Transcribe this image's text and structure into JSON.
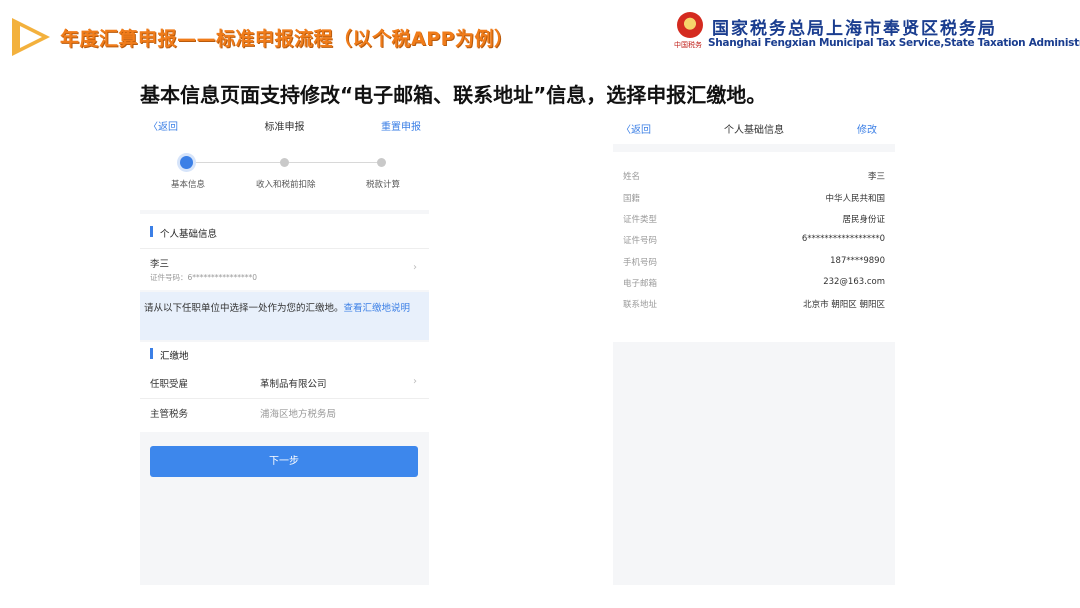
{
  "header": {
    "title": "年度汇算申报——标准申报流程（以个税APP为例）",
    "org_cn": "国家税务总局上海市奉贤区税务局",
    "org_en": "Shanghai Fengxian Municipal Tax Service,State Taxation Administration",
    "emblem_caption": "中国税务"
  },
  "caption": "基本信息页面支持修改“电子邮箱、联系地址”信息，选择申报汇缴地。",
  "left_phone": {
    "back": "返回",
    "title": "标准申报",
    "reset": "重置申报",
    "steps": [
      "基本信息",
      "收入和税前扣除",
      "税款计算"
    ],
    "personal_section": "个人基础信息",
    "person_name": "李三",
    "person_id": "证件号码：6****************0",
    "notice_text": "请从以下任职单位中选择一处作为您的汇缴地。",
    "notice_link": "查看汇缴地说明",
    "settle_section": "汇缴地",
    "employer_label": "任职受雇",
    "employer_value": "革制品有限公司",
    "tax_office_label": "主管税务",
    "tax_office_value": "浦海区地方税务局",
    "next": "下一步"
  },
  "right_phone": {
    "back": "返回",
    "title": "个人基础信息",
    "edit": "修改",
    "fields": [
      {
        "label": "姓名",
        "value": "李三"
      },
      {
        "label": "国籍",
        "value": "中华人民共和国"
      },
      {
        "label": "证件类型",
        "value": "居民身份证"
      },
      {
        "label": "证件号码",
        "value": "6*****************0"
      },
      {
        "label": "手机号码",
        "value": "187****9890"
      },
      {
        "label": "电子邮箱",
        "value": "232@163.com"
      },
      {
        "label": "联系地址",
        "value": "北京市 朝阳区 朝阳区"
      }
    ]
  },
  "colors": {
    "accent": "#3b7fe6",
    "title": "#f07c1a",
    "org": "#1a3d8f"
  }
}
